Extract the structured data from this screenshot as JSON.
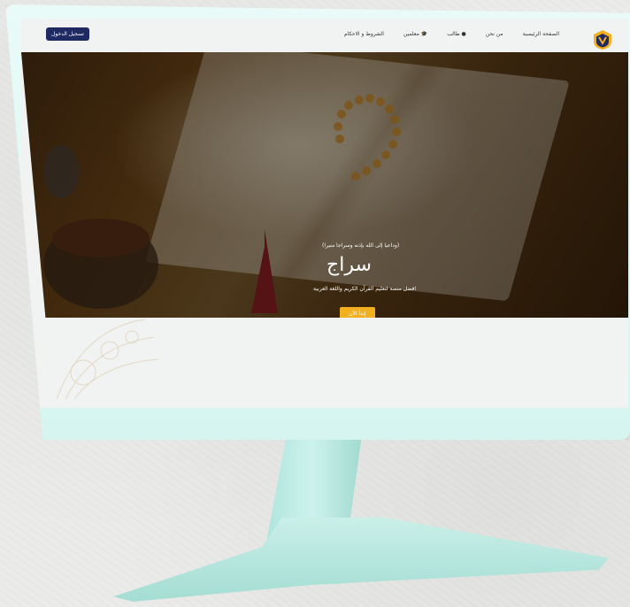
{
  "nav": {
    "home": "الصفحة الرئيسية",
    "about": "من نحن",
    "student": "طالب",
    "teacher": "معلمين",
    "terms": "الشروط و الاحكام",
    "login": "تسجيل الدخول"
  },
  "hero": {
    "tagline": "(وداعيا إلى الله بإذنه وسراجا منيرا)",
    "title": "سراج",
    "subtitle": "افضل منصة لتعليم القرآن الكريم واللغة العربية",
    "cta": "إبدأ الآن"
  },
  "colors": {
    "primary": "#1f2a63",
    "accent": "#f2b01e",
    "monitor": "#d6f5f0"
  }
}
